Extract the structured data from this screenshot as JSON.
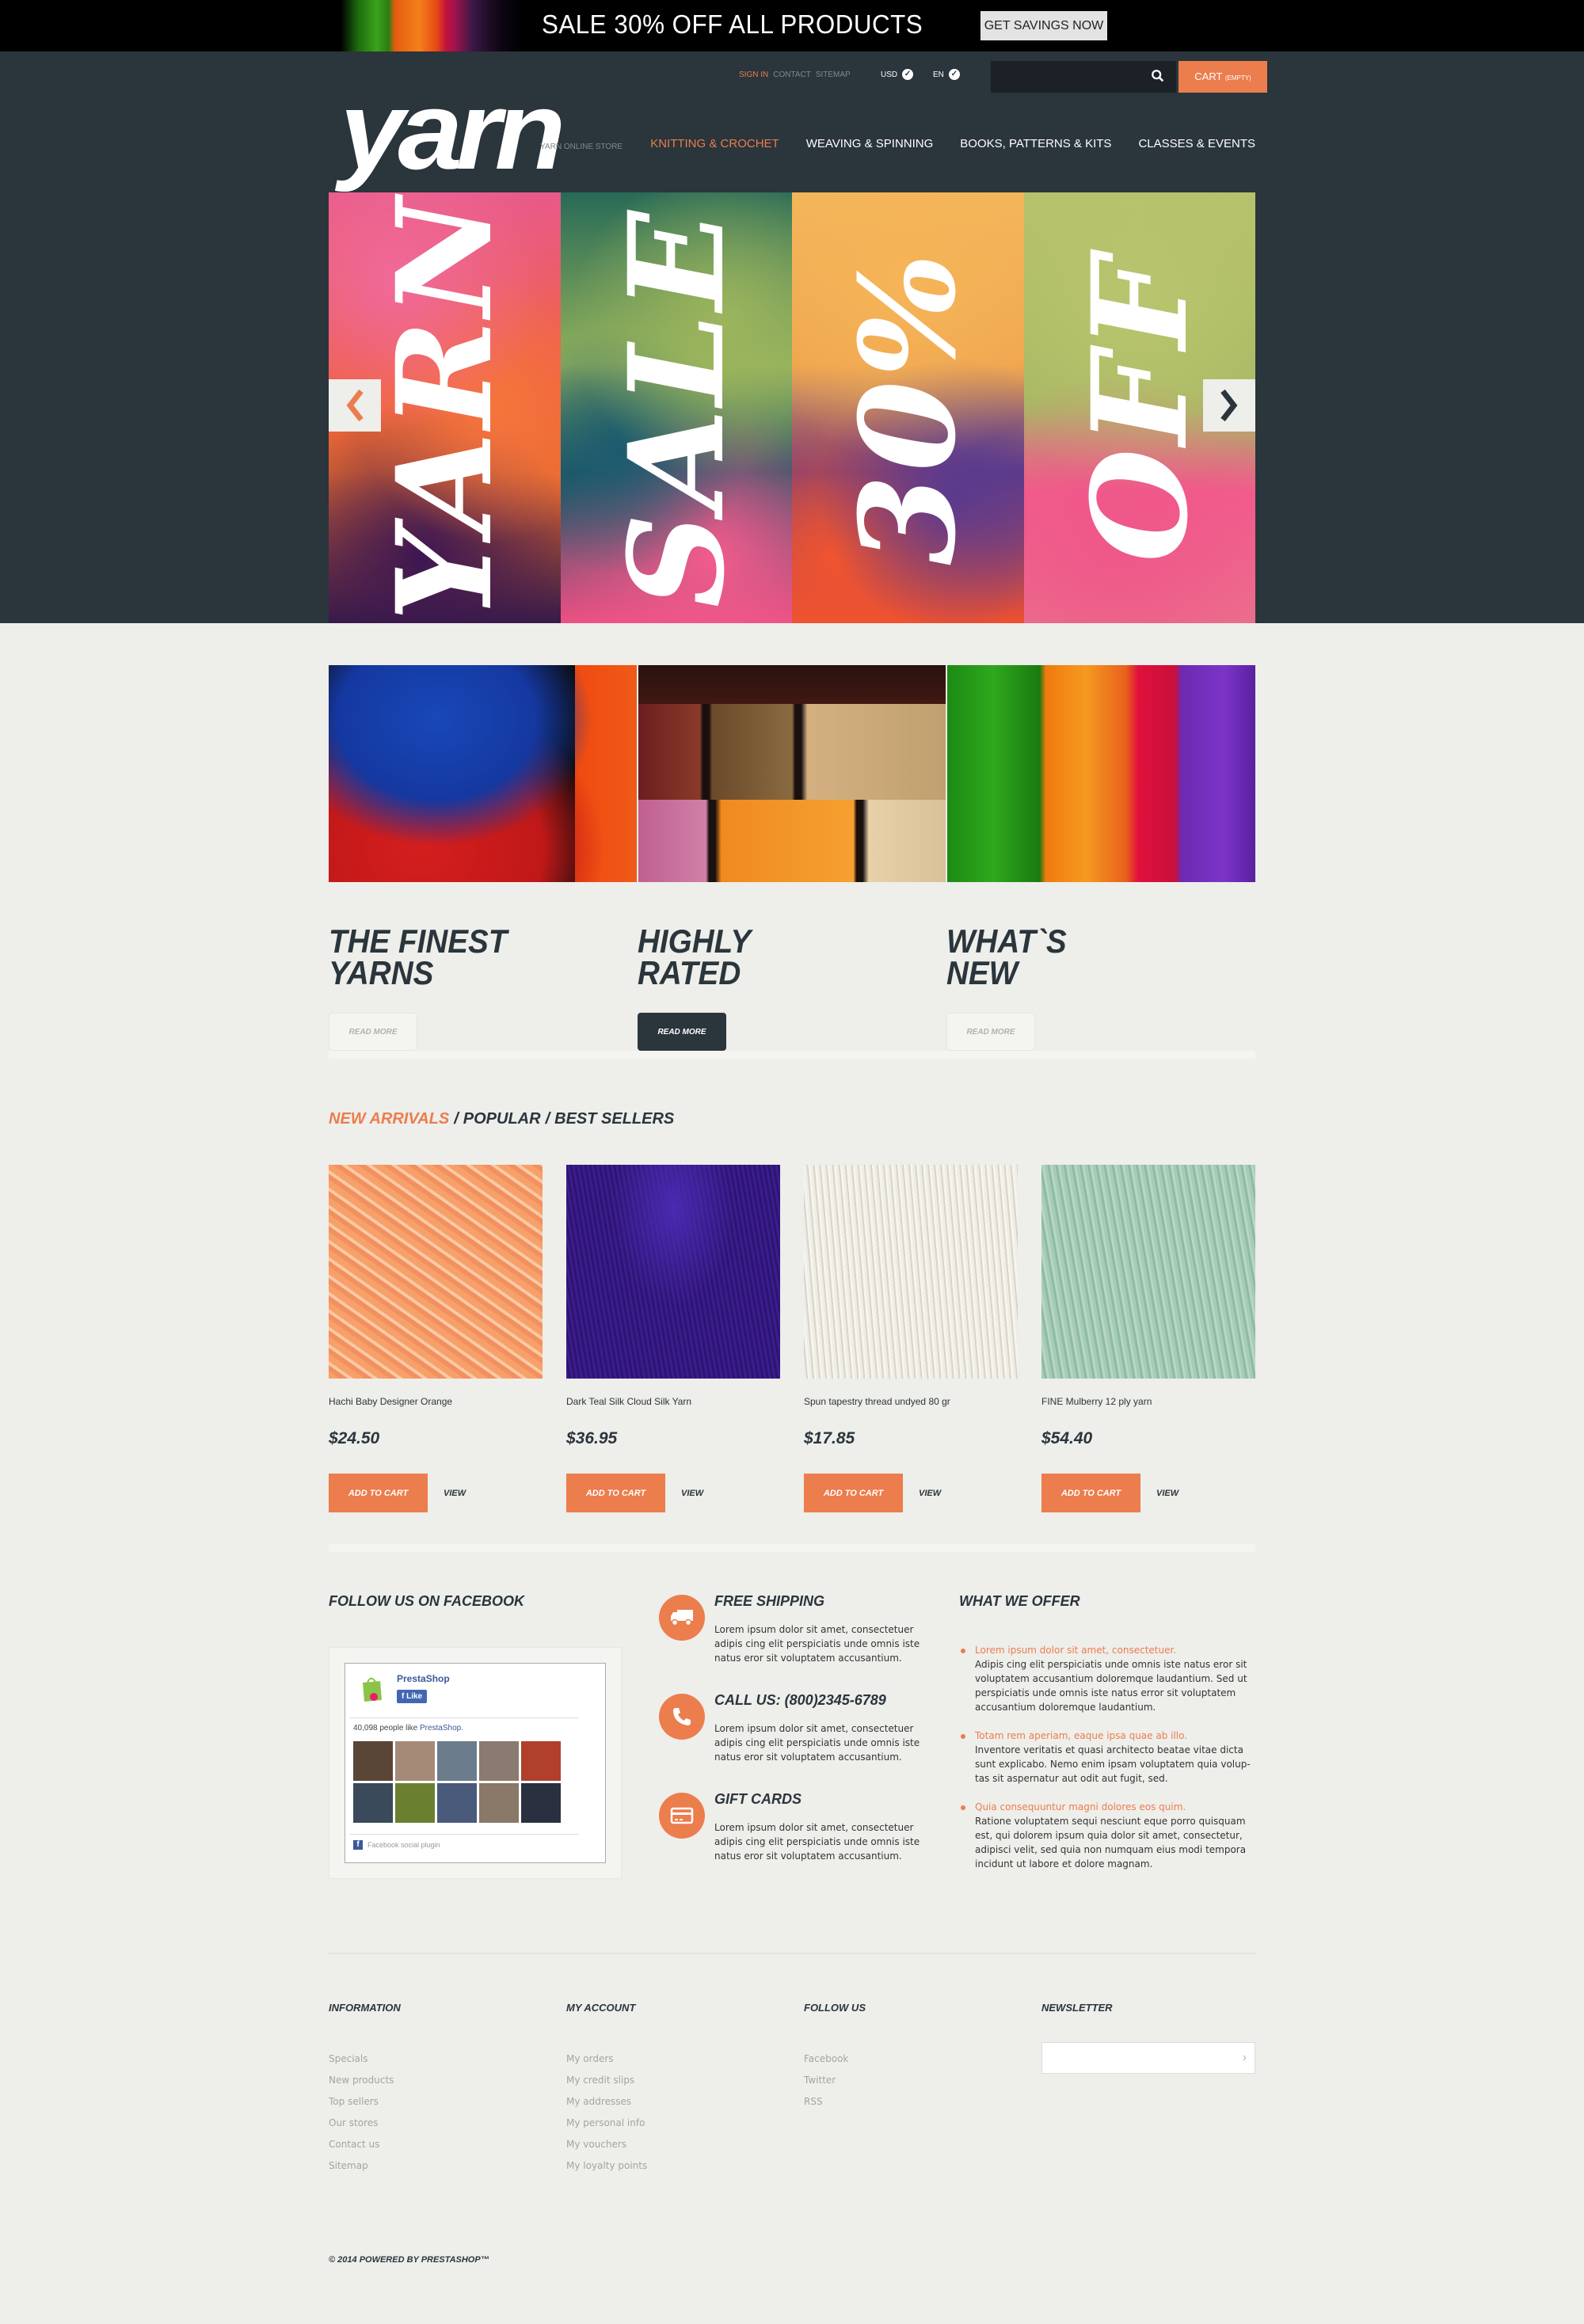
{
  "promo_banner": {
    "text": "SALE 30% OFF ALL PRODUCTS",
    "button": "GET SAVINGS NOW"
  },
  "header": {
    "logo": "yarn",
    "tagline": "YARN ONLINE STORE",
    "top_links": [
      "SIGN IN",
      "CONTACT",
      "SITEMAP"
    ],
    "currency": "USD",
    "language": "EN",
    "search_placeholder": "",
    "cart_label": "CART",
    "cart_status": "(EMPTY)",
    "nav": [
      "KNITTING & CROCHET",
      "WEAVING & SPINNING",
      "BOOKS, PATTERNS & KITS",
      "CLASSES & EVENTS"
    ],
    "active_nav": 0
  },
  "slider": {
    "words": [
      "YARN",
      "SALE",
      "30%",
      "OFF"
    ],
    "prev_icon": "chevron-left-icon",
    "next_icon": "chevron-right-icon"
  },
  "promos": [
    {
      "title": "THE FINEST YARNS",
      "button": "READ MORE",
      "active": false
    },
    {
      "title": "HIGHLY RATED",
      "button": "READ MORE",
      "active": true
    },
    {
      "title": "WHAT`S NEW",
      "button": "READ MORE",
      "active": false
    }
  ],
  "product_tabs": {
    "tabs": [
      "NEW ARRIVALS",
      "POPULAR",
      "BEST SELLERS"
    ],
    "separator": "/",
    "active": 0
  },
  "products": [
    {
      "name": "Hachi Baby Designer Orange",
      "price": "$24.50",
      "add_to_cart": "ADD TO CART",
      "view": "VIEW"
    },
    {
      "name": "Dark Teal Silk Cloud Silk Yarn",
      "price": "$36.95",
      "add_to_cart": "ADD TO CART",
      "view": "VIEW"
    },
    {
      "name": "Spun tapestry thread undyed 80 gr",
      "price": "$17.85",
      "add_to_cart": "ADD TO CART",
      "view": "VIEW"
    },
    {
      "name": "FINE Mulberry 12 ply yarn",
      "price": "$54.40",
      "add_to_cart": "ADD TO CART",
      "view": "VIEW"
    }
  ],
  "facebook": {
    "heading": "FOLLOW US ON FACEBOOK",
    "page_name": "PrestaShop",
    "like_label": "Like",
    "count_text": "40,098 people like",
    "count_link": "PrestaShop",
    "plugin_label": "Facebook social plugin"
  },
  "services": [
    {
      "icon": "truck-icon",
      "title": "FREE SHIPPING",
      "text": "Lorem ipsum dolor sit amet, consectetuer adipis cing elit perspiciatis unde omnis iste natus eror sit voluptatem accusantium."
    },
    {
      "icon": "phone-icon",
      "title": "CALL US: (800)2345-6789",
      "text": "Lorem ipsum dolor sit amet, consectetuer adipis cing elit perspiciatis unde omnis iste natus eror sit voluptatem accusantium."
    },
    {
      "icon": "credit-card-icon",
      "title": "GIFT CARDS",
      "text": "Lorem ipsum dolor sit amet, consectetuer adipis cing elit perspiciatis unde omnis iste natus eror sit voluptatem accusantium."
    }
  ],
  "offer": {
    "heading": "WHAT WE OFFER",
    "items": [
      {
        "lead": "Lorem ipsum dolor sit amet, consectetuer.",
        "text": "Adipis cing elit perspiciatis unde omnis iste natus eror sit voluptatem accusantium doloremque laudantium. Sed ut perspiciatis unde omnis iste natus error sit voluptatem accusantium doloremque laudantium."
      },
      {
        "lead": "Totam rem aperiam, eaque ipsa quae ab illo.",
        "text": "Inventore veritatis et quasi architecto beatae vitae dicta sunt explicabo. Nemo enim ipsam voluptatem quia volup-tas sit aspernatur aut odit aut fugit, sed."
      },
      {
        "lead": "Quia consequuntur magni dolores eos quim.",
        "text": "Ratione voluptatem sequi nesciunt eque porro quisquam est, qui dolorem ipsum quia dolor sit amet, consectetur, adipisci velit, sed quia non numquam eius modi tempora incidunt ut labore et dolore magnam."
      }
    ]
  },
  "footer": {
    "information": {
      "heading": "INFORMATION",
      "links": [
        "Specials",
        "New products",
        "Top sellers",
        "Our stores",
        "Contact us",
        "Sitemap"
      ]
    },
    "my_account": {
      "heading": "MY ACCOUNT",
      "links": [
        "My orders",
        "My credit slips",
        "My addresses",
        "My personal info",
        "My vouchers",
        "My loyalty points"
      ]
    },
    "follow_us": {
      "heading": "FOLLOW US",
      "links": [
        "Facebook",
        "Twitter",
        "RSS"
      ]
    },
    "newsletter": {
      "heading": "NEWSLETTER",
      "placeholder": "",
      "submit_icon": "chevron-right-icon"
    },
    "copyright": "© 2014 POWERED BY PRESTASHOP™"
  },
  "colors": {
    "accent": "#ec7d4d",
    "dark": "#2a353c",
    "background": "#eeeeea"
  }
}
